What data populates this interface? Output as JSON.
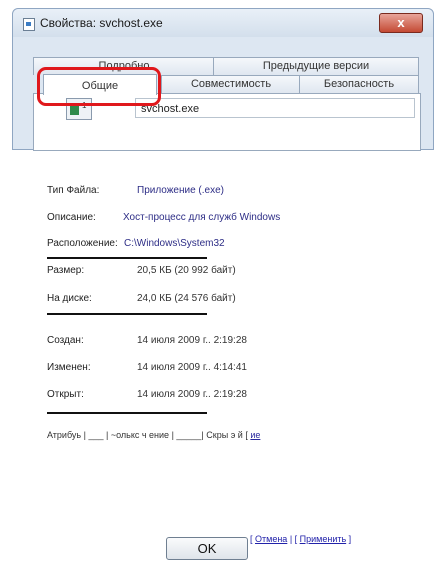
{
  "window": {
    "title": "Свойства: svchost.exe",
    "close_glyph": "x",
    "colors": {
      "highlight_ring": "#e0181c",
      "link_blue": "#2d2d86"
    }
  },
  "tabs": {
    "details": "Подробно",
    "previous_versions": "Предыдущие версии",
    "general": "Общие",
    "compatibility": "Совместимость",
    "security": "Безопасность"
  },
  "file": {
    "name": "svchost.exe",
    "icon_number": "1"
  },
  "properties": {
    "type_label": "Тип Файла:",
    "type_value": "Приложение (.exe)",
    "description_label": "Описание:",
    "description_value": "Хост-процесс для служб Windows",
    "location_label": "Расположение:",
    "location_value": "C:\\Windows\\System32",
    "size_label": "Размер:",
    "size_value": "20,5 КБ (20 992 байт)",
    "ondisk_label": "На диске:",
    "ondisk_value": "24,0 КБ (24 576 байт)",
    "created_label": "Создан:",
    "created_value": "14 июля 2009 г.. 2:19:28",
    "modified_label": "Изменен:",
    "modified_value": "14 июля 2009 г.. 4:14:41",
    "opened_label": "Открыт:",
    "opened_value": "14 июля 2009 г.. 2:19:28"
  },
  "attributes": {
    "label": "Атрибуь",
    "readonly": "~олькс ч ение",
    "hidden": "Скры э й",
    "other": "ие"
  },
  "buttons": {
    "ok": "OK",
    "cancel": "Отмена",
    "apply": "Применить"
  }
}
